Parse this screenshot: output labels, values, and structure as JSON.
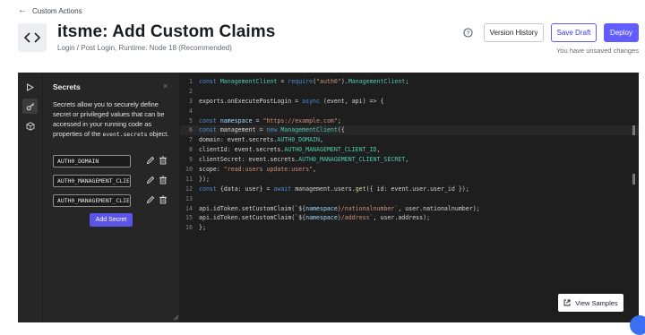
{
  "breadcrumb": {
    "back_label": "Custom Actions"
  },
  "header": {
    "title": "itsme: Add Custom Claims",
    "subtitle": "Login / Post Login, Runtime: Node 18 (Recommended)",
    "version_history_label": "Version History",
    "save_draft_label": "Save Draft",
    "deploy_label": "Deploy",
    "unsaved_text": "You have unsaved changes"
  },
  "colors": {
    "primary": "#635dff",
    "editor_bg": "#1e1e1e",
    "panel_bg": "#262626",
    "keyword": "#4a8fd8",
    "string": "#ce9178",
    "type": "#4ec9b0"
  },
  "rail": {
    "icons": [
      "play-icon",
      "key-icon",
      "package-icon"
    ],
    "active": "key-icon"
  },
  "secrets_panel": {
    "title": "Secrets",
    "close": "×",
    "description": "Secrets allow you to securely define secret or privileged values that can be accessed in your running code as properties of the",
    "description_code": "event.secrets",
    "description_end": "object.",
    "secrets": [
      {
        "name": "AUTH0_DOMAIN"
      },
      {
        "name": "AUTH0_MANAGEMENT_CLIE…"
      },
      {
        "name": "AUTH0_MANAGEMENT_CLIE…"
      }
    ],
    "add_label": "Add Secret"
  },
  "editor": {
    "active_line": 6,
    "lines": [
      [
        {
          "t": "const ",
          "c": "k"
        },
        {
          "t": "ManagementClient",
          "c": "t"
        },
        {
          "t": " = "
        },
        {
          "t": "require",
          "c": "k"
        },
        {
          "t": "("
        },
        {
          "t": "\"auth0\"",
          "c": "s"
        },
        {
          "t": ")."
        },
        {
          "t": "ManagementClient",
          "c": "t"
        },
        {
          "t": ";"
        }
      ],
      [],
      [
        {
          "t": "exports.onExecutePostLogin = "
        },
        {
          "t": "async",
          "c": "k"
        },
        {
          "t": " (event, api) => {"
        }
      ],
      [],
      [
        {
          "t": "const ",
          "c": "k"
        },
        {
          "t": "namespace",
          "c": "p"
        },
        {
          "t": " = "
        },
        {
          "t": "\"https://example.com\"",
          "c": "s"
        },
        {
          "t": ";"
        }
      ],
      [
        {
          "t": "const ",
          "c": "k"
        },
        {
          "t": "management = "
        },
        {
          "t": "new ",
          "c": "k"
        },
        {
          "t": "ManagementClient",
          "c": "t"
        },
        {
          "t": "({"
        }
      ],
      [
        {
          "t": "domain: event.secrets."
        },
        {
          "t": "AUTH0_DOMAIN",
          "c": "t"
        },
        {
          "t": ","
        }
      ],
      [
        {
          "t": "clientId: event.secrets."
        },
        {
          "t": "AUTH0_MANAGEMENT_CLIENT_ID",
          "c": "t"
        },
        {
          "t": ","
        }
      ],
      [
        {
          "t": "clientSecret: event.secrets."
        },
        {
          "t": "AUTH0_MANAGEMENT_CLIENT_SECRET",
          "c": "t"
        },
        {
          "t": ","
        }
      ],
      [
        {
          "t": "scope: "
        },
        {
          "t": "\"read:users update:users\"",
          "c": "s"
        },
        {
          "t": ","
        }
      ],
      [
        {
          "t": "});"
        }
      ],
      [
        {
          "t": "const ",
          "c": "k"
        },
        {
          "t": "{data: user} = "
        },
        {
          "t": "await",
          "c": "k"
        },
        {
          "t": " management.users."
        },
        {
          "t": "get",
          "c": "f"
        },
        {
          "t": "({ id: event.user.user_id });"
        }
      ],
      [],
      [
        {
          "t": "api.idToken.setCustomClaim(`${"
        },
        {
          "t": "namespace",
          "c": "p"
        },
        {
          "t": "}/nationalnumber`",
          "c": "s"
        },
        {
          "t": ", user.nationalnumber);"
        }
      ],
      [
        {
          "t": "api.idToken.setCustomClaim(`${"
        },
        {
          "t": "namespace",
          "c": "p"
        },
        {
          "t": "}/address`",
          "c": "s"
        },
        {
          "t": ", user.address);"
        }
      ],
      [
        {
          "t": "};"
        }
      ]
    ]
  },
  "view_samples_label": "View Samples"
}
